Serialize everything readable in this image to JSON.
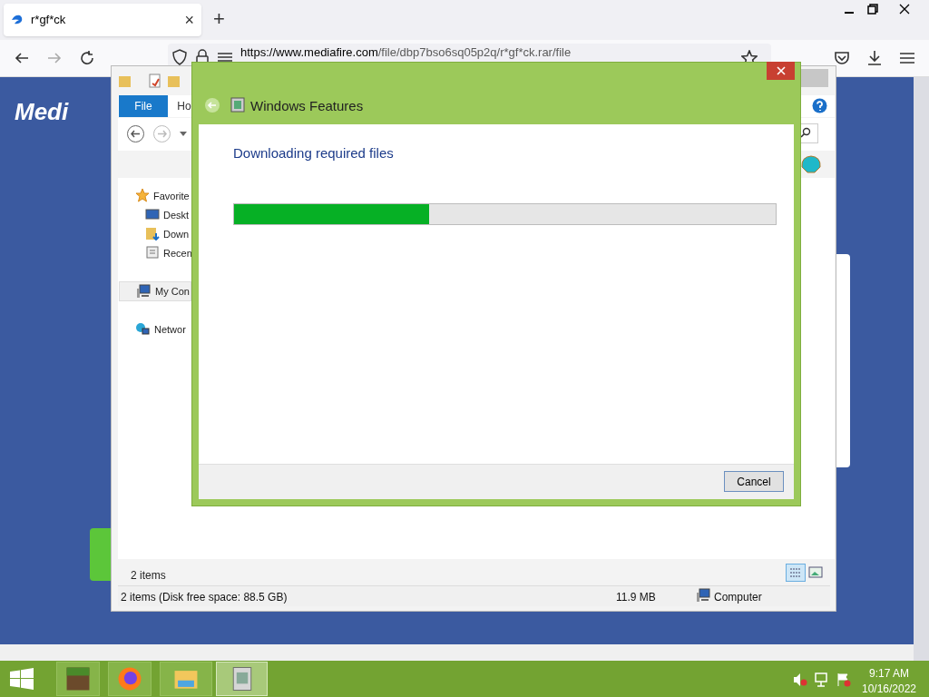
{
  "browser": {
    "tab": {
      "title": "r*gf*ck",
      "close": "×"
    },
    "new_tab": "+",
    "url": {
      "domain": "https://www.mediafire.com",
      "path": "/file/dbp7bso6sq05p2q/r*gf*ck.rar/file"
    },
    "page_logo": "Medi"
  },
  "explorer": {
    "ribbon_tabs": [
      {
        "label": "File",
        "selected": true
      },
      {
        "label": "Ho",
        "selected": false
      }
    ],
    "nav_items": [
      {
        "label": "Favorite",
        "children": [
          {
            "label": "Deskt"
          },
          {
            "label": "Down"
          },
          {
            "label": "Recen"
          }
        ]
      },
      {
        "label": "My Con",
        "selected": true
      },
      {
        "label": "Networ",
        "selected": false
      }
    ],
    "item_count": "2 items",
    "status_bar": {
      "summary": "2 items (Disk free space: 88.5 GB)",
      "size": "11.9 MB",
      "location": "Computer"
    }
  },
  "dialog": {
    "title": "Windows Features",
    "heading": "Downloading required files",
    "progress": {
      "level": 0.36
    },
    "buttons": [
      "Cancel"
    ]
  },
  "taskbar": {
    "apps": [
      {
        "active": false
      },
      {
        "active": false
      },
      {
        "active": false
      },
      {
        "active": true
      }
    ],
    "time": "9:17 AM",
    "date": "10/16/2022"
  }
}
